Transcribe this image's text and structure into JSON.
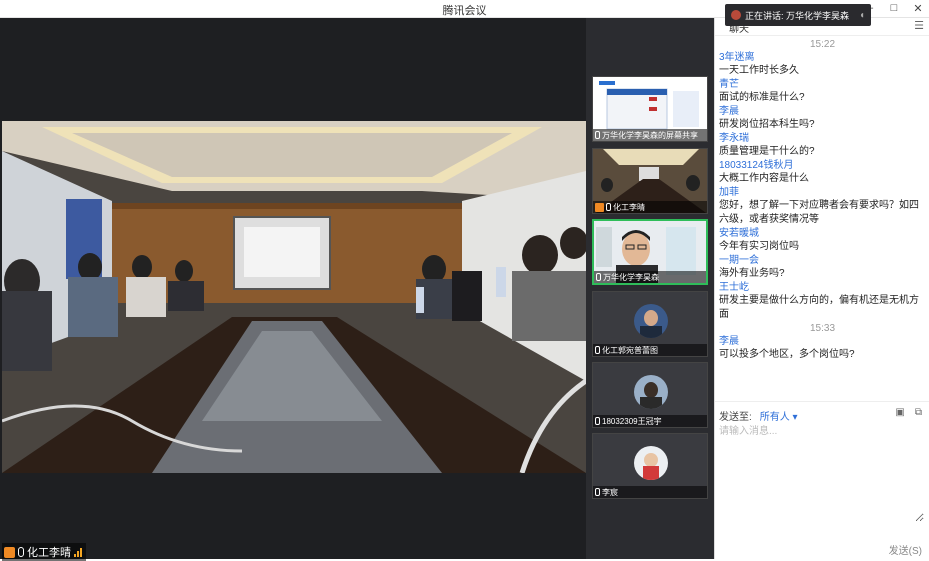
{
  "window": {
    "title": "腾讯会议",
    "controls": [
      "–",
      "□",
      "✕"
    ]
  },
  "main_video": {
    "speaker_name": "化工李晴"
  },
  "participants": [
    {
      "name": "万华化学李昊森的屏幕共享"
    },
    {
      "name": "化工李晴"
    },
    {
      "name": "万华化学李昊森"
    },
    {
      "name": "化工郭宛普蕾图"
    },
    {
      "name": "18032309王冠宇"
    },
    {
      "name": "李宸"
    }
  ],
  "chat": {
    "tab_label": "聊天",
    "more_label": "☰",
    "speaking_now": "正在讲话: 万华化学李昊森",
    "messages": [
      {
        "type": "time",
        "text": "15:22"
      },
      {
        "sender": "3年迷离",
        "text": "一天工作时长多久"
      },
      {
        "sender": "青芒",
        "text": "面试的标准是什么?"
      },
      {
        "sender": "李晨",
        "text": "研发岗位招本科生吗?"
      },
      {
        "sender": "李永瑞",
        "text": "质量管理是干什么的?"
      },
      {
        "sender": "18033124钱秋月",
        "text": "大概工作内容是什么"
      },
      {
        "sender": "加菲",
        "text": "您好，想了解一下对应聘者会有要求吗？如四六级，或者获奖情况等"
      },
      {
        "sender": "安若暖城",
        "text": "今年有实习岗位吗"
      },
      {
        "sender": "一期一会",
        "text": "海外有业务吗?"
      },
      {
        "sender": "王士屹",
        "text": "研发主要是做什么方向的，偏有机还是无机方面"
      },
      {
        "type": "time",
        "text": "15:33"
      },
      {
        "sender": "李晨",
        "text": "可以投多个地区，多个岗位吗?"
      }
    ],
    "send_to_label": "发送至:",
    "send_to_target": "所有人 ▾",
    "input_placeholder": "请输入消息...",
    "send_label": "发送(S)",
    "tool_icons": [
      "folder-icon",
      "screenshot-icon"
    ]
  },
  "colors": {
    "accent_blue": "#2e6fd8",
    "active_green": "#2fbd5a",
    "mic_orange": "#f08a24"
  }
}
